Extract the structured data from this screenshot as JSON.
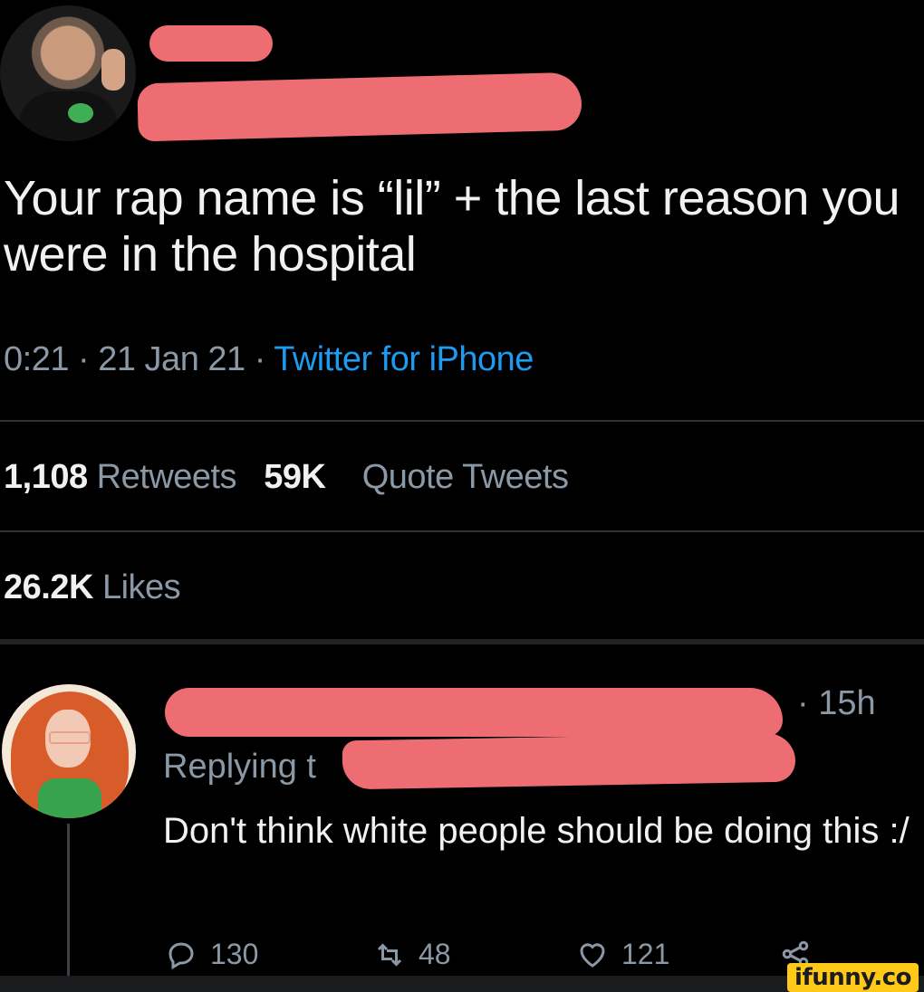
{
  "tweet": {
    "text": "Your rap name is “lil” + the last reason you were in the hospital",
    "time": "0:21 · 21 Jan 21 · ",
    "client": "Twitter for iPhone",
    "retweets_count": "1,108",
    "retweets_label": "Retweets",
    "quotes_count": "59K",
    "quotes_label": "Quote Tweets",
    "likes_count": "26.2K",
    "likes_label": "Likes"
  },
  "reply": {
    "time": "· 15h",
    "replying_prefix": "Replying t",
    "text": "Don't think white people should be doing this :/",
    "replies": "130",
    "retweets": "48",
    "likes": "121"
  },
  "icons": {
    "reply": "reply-icon",
    "retweet": "retweet-icon",
    "like": "heart-icon",
    "share": "share-icon"
  },
  "colors": {
    "background": "#000000",
    "link": "#1d9bf0",
    "redaction": "#ee6d73",
    "watermark": "#ffc917"
  },
  "watermark": "ifunny.co"
}
